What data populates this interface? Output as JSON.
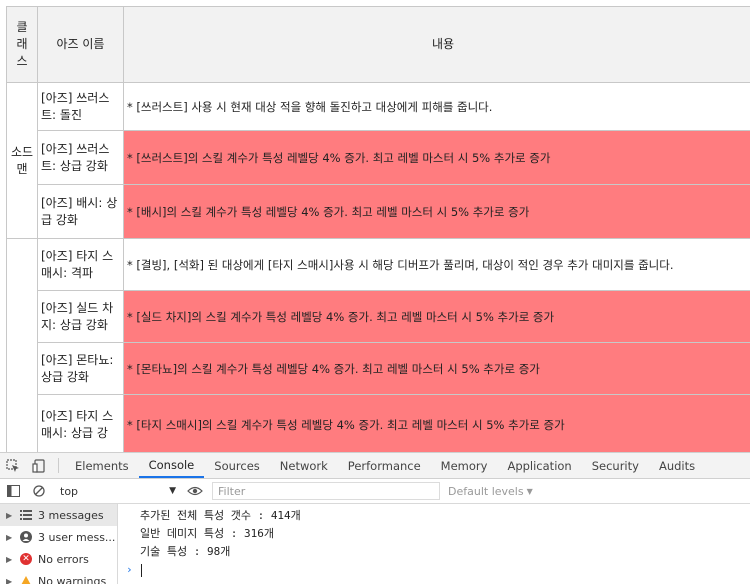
{
  "table": {
    "headers": {
      "class": "클래스",
      "name": "아즈 이름",
      "desc": "내용"
    },
    "groups": [
      {
        "class_label": "소드맨",
        "rows": [
          {
            "name": "[아즈] 쓰러스트: 돌진",
            "desc": " * [쓰러스트] 사용 시 현재 대상 적을 향해 돌진하고 대상에게 피해를 줍니다.",
            "highlight": false
          },
          {
            "name": "[아즈] 쓰러스트: 상급 강화",
            "desc": "* [쓰러스트]의 스킬 계수가 특성 레벨당 4% 증가. 최고 레벨 마스터 시 5% 추가로 증가",
            "highlight": true
          },
          {
            "name": "[아즈] 배시: 상급 강화",
            "desc": "* [배시]의 스킬 계수가 특성 레벨당 4% 증가. 최고 레벨 마스터 시 5% 추가로 증가",
            "highlight": true
          }
        ]
      },
      {
        "class_label": "",
        "rows": [
          {
            "name": "[아즈] 타지 스매시: 격파",
            "desc": " * [결빙], [석화] 된 대상에게 [타지 스매시]사용 시 해당 디버프가 풀리며, 대상이 적인 경우 추가 대미지를 줍니다.",
            "highlight": false
          },
          {
            "name": "[아즈] 실드 차지: 상급 강화",
            "desc": "* [실드 차지]의 스킬 계수가 특성 레벨당 4% 증가. 최고 레벨 마스터 시 5% 추가로 증가",
            "highlight": true
          },
          {
            "name": "[아즈] 몬타뇨: 상급 강화",
            "desc": " * [몬타뇨]의 스킬 계수가 특성 레벨당 4% 증가. 최고 레벨 마스터 시 5% 추가로 증가",
            "highlight": true
          },
          {
            "name": "[아즈] 타지 스매시: 상급 강",
            "desc": " * [타지 스매시]의 스킬 계수가 특성 레벨당 4% 증가. 최고 레벨 마스터 시 5% 추가로 증가",
            "highlight": true
          }
        ]
      }
    ],
    "highlight_color": "#ff7c7f"
  },
  "devtools": {
    "tabs": [
      "Elements",
      "Console",
      "Sources",
      "Network",
      "Performance",
      "Memory",
      "Application",
      "Security",
      "Audits"
    ],
    "active_tab": "Console",
    "context": "top",
    "filter_placeholder": "Filter",
    "levels_label": "Default levels",
    "sidebar": [
      {
        "label": "3 messages",
        "icon": "list-icon",
        "selected": true
      },
      {
        "label": "3 user mess...",
        "icon": "user-icon",
        "selected": false
      },
      {
        "label": "No errors",
        "icon": "error-icon",
        "selected": false
      },
      {
        "label": "No warnings",
        "icon": "warning-icon",
        "selected": false
      }
    ],
    "log": [
      "추가된 전체 특성 갯수 : 414개",
      "일반 데미지 특성 : 316개",
      "기술 특성 : 98개"
    ],
    "accent_color": "#1a73e8"
  }
}
